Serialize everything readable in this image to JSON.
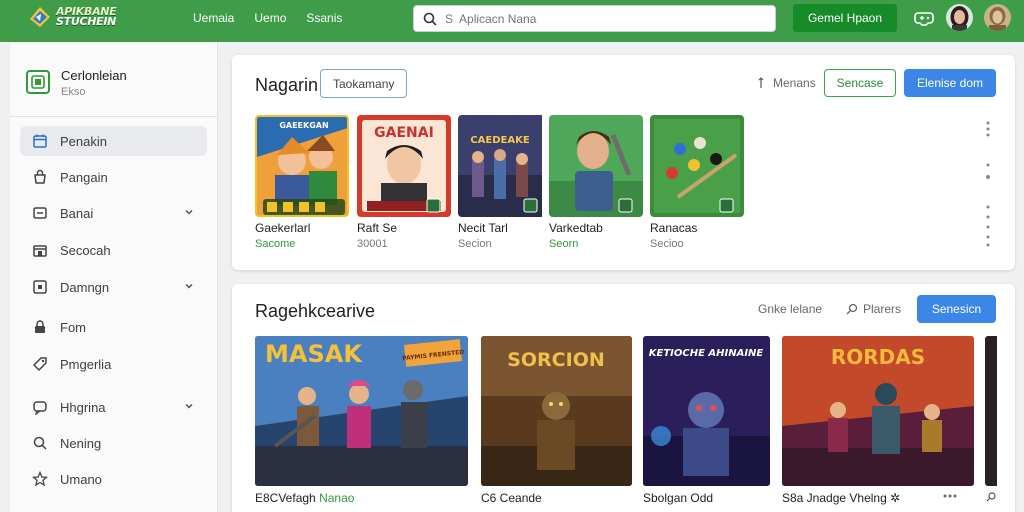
{
  "brand": {
    "line1": "APIKBANE",
    "line2": "STUCHEIN"
  },
  "topnav": [
    "Uemaia",
    "Uemo",
    "Ssanis"
  ],
  "search": {
    "placeholder": "S  Aplicacn Nana"
  },
  "top_button": "Gemel Hpaon",
  "colors": {
    "brand_green": "#3f9d4a",
    "button_green": "#178a2a",
    "accent_blue": "#3b86e6",
    "meta_green": "#2e9a3c"
  },
  "sidebar": {
    "profile": {
      "name": "Cerlonleian",
      "sub": "Ekso"
    },
    "items": [
      {
        "label": "Penakin",
        "icon": "calendar-icon",
        "active": true,
        "chevron": false
      },
      {
        "label": "Pangain",
        "icon": "bag-icon",
        "active": false,
        "chevron": false
      },
      {
        "label": "Banai",
        "icon": "window-icon",
        "active": false,
        "chevron": true
      },
      {
        "label": "Secocah",
        "icon": "store-icon",
        "active": false,
        "chevron": false
      },
      {
        "label": "Damngn",
        "icon": "frame-icon",
        "active": false,
        "chevron": true
      },
      {
        "label": "Fom",
        "icon": "lock-icon",
        "active": false,
        "chevron": false
      },
      {
        "label": "Pmgerlia",
        "icon": "tag-icon",
        "active": false,
        "chevron": false
      },
      {
        "label": "Hhgrina",
        "icon": "chat-icon",
        "active": false,
        "chevron": true
      },
      {
        "label": "Nening",
        "icon": "search-icon",
        "active": false,
        "chevron": false
      },
      {
        "label": "Umano",
        "icon": "star-icon",
        "active": false,
        "chevron": false
      }
    ]
  },
  "section1": {
    "title": "Nagarin",
    "chip": "Taokamany",
    "link": "Menans",
    "btn_outline": "Sencase",
    "btn_blue": "Elenise dom",
    "apps": [
      {
        "name": "Gaekerlarl",
        "meta": "Sacome",
        "green": true
      },
      {
        "name": "Raft Se",
        "meta": "30001",
        "green": false
      },
      {
        "name": "Necit Tarl",
        "meta": "Secion",
        "green": false
      },
      {
        "name": "Varkedtab",
        "meta": "Seorn",
        "green": true
      },
      {
        "name": "Ranacas",
        "meta": "Secioo",
        "green": false
      }
    ],
    "thumb_texts": [
      "GAEEKGAN",
      "GAENAI",
      "CAEDEAKE"
    ]
  },
  "section2": {
    "title": "Ragehkcearive",
    "link1": "Gnke lelane",
    "link2": "Plarers",
    "btn_blue": "Senesicn",
    "games": [
      {
        "title": "MASAK",
        "name": "E8CVefagh",
        "name_green": "Nanao",
        "banner": "PAYMIS FRENSTED"
      },
      {
        "title": "SORCION",
        "name": "C6 Ceande"
      },
      {
        "title": "KETIOCHE AHINAINE",
        "name": "Sbolgan Odd"
      },
      {
        "title": "RORDAS",
        "name": "S8a Jnadge Vhelng",
        "name_tail": "✲"
      }
    ]
  }
}
